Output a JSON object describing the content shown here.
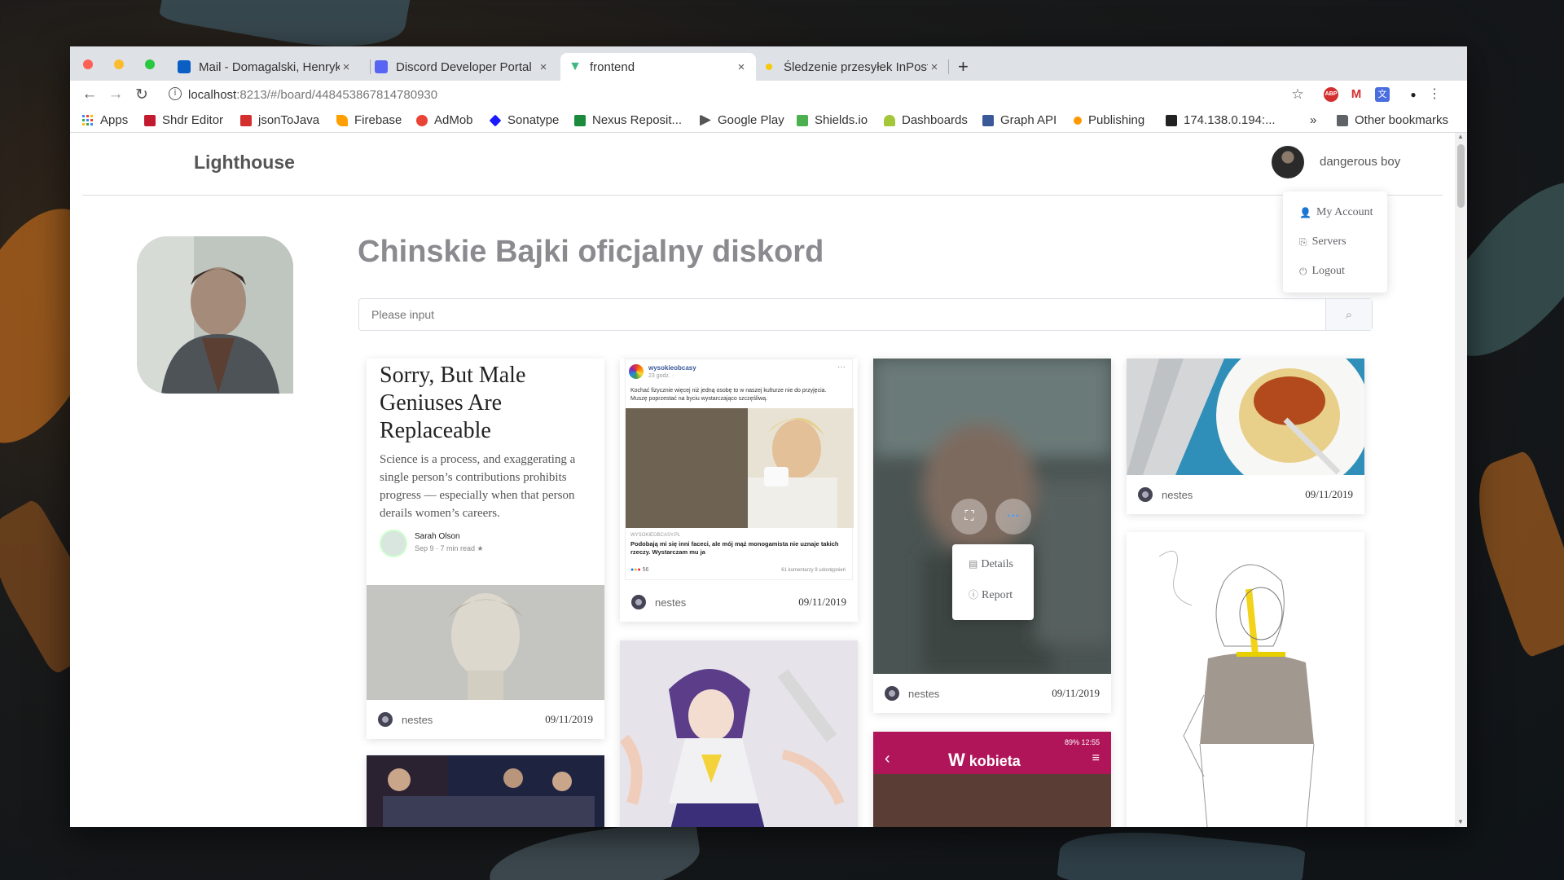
{
  "browser": {
    "tabs": [
      {
        "title": "Mail - Domagalski, Henryk",
        "color": "#0a5ec4"
      },
      {
        "title": "Discord Developer Portal",
        "color": "#5865f2"
      },
      {
        "title": "frontend",
        "color": "#41b883"
      },
      {
        "title": "Śledzenie przesyłek InPost",
        "color": "#f6c90e"
      }
    ],
    "close_glyph": "×",
    "new_tab_glyph": "+",
    "url_host": "localhost",
    "url_rest": ":8213/#/board/448453867814780930",
    "bookmarks": [
      {
        "label": "Apps",
        "color": "#4285f4"
      },
      {
        "label": "Shdr Editor",
        "color": "#c21b2f"
      },
      {
        "label": "jsonToJava",
        "color": "#d32f2f"
      },
      {
        "label": "Firebase",
        "color": "#ffa000"
      },
      {
        "label": "AdMob",
        "color": "#ea4335"
      },
      {
        "label": "Sonatype",
        "color": "#1b1aff"
      },
      {
        "label": "Nexus Reposit...",
        "color": "#1c8a3c"
      },
      {
        "label": "Google Play",
        "color": "#555555"
      },
      {
        "label": "Shields.io",
        "color": "#4caf50"
      },
      {
        "label": "Dashboards",
        "color": "#a4c639"
      },
      {
        "label": "Graph API",
        "color": "#3b5998"
      },
      {
        "label": "Publishing",
        "color": "#ff9800"
      },
      {
        "label": "174.138.0.194:...",
        "color": "#222222"
      }
    ],
    "overflow_glyph": "»",
    "other_bookmarks": "Other bookmarks"
  },
  "app": {
    "brand": "Lighthouse",
    "username": "dangerous boy",
    "menu": {
      "my_account": "My Account",
      "servers": "Servers",
      "logout": "Logout"
    },
    "board_title": "Chinskie Bajki oficjalny diskord",
    "search_placeholder": "Please input"
  },
  "posts": [
    {
      "article_title": "Sorry, But Male Geniuses Are Replaceable",
      "article_text": "Science is a process, and exaggerating a single person’s contributions prohibits progress — especially when that person derails women’s careers.",
      "author": "Sarah Olson",
      "meta": "Sep 9 · 7 min read ★",
      "user": "nestes",
      "date": "09/11/2019"
    },
    {
      "fb_page": "wysokieobcasy",
      "fb_time": "23 godz. ·",
      "fb_text": "Kochać fizycznie więcej niż jedną osobę to w naszej kulturze nie do przyjęcia. Muszę poprzestać na byciu wystarczająco szczęśliwą.",
      "fb_site": "WYSOKIEOBCASY.PL",
      "fb_headline": "Podobają mi się inni faceci, ale mój mąż monogamista nie uznaje takich rzeczy. Wystarczam mu ja",
      "fb_reactions": "56",
      "fb_stats": "61 komentarzy  9 udostępnień",
      "user": "nestes",
      "date": "09/11/2019"
    },
    {
      "user": "nestes",
      "date": "09/11/2019",
      "popover": {
        "details": "Details",
        "report": "Report"
      }
    },
    {
      "user": "nestes",
      "date": "09/11/2019"
    },
    {
      "status_time": "12:55",
      "status_battery": "89%",
      "app_name": "kobieta"
    }
  ]
}
